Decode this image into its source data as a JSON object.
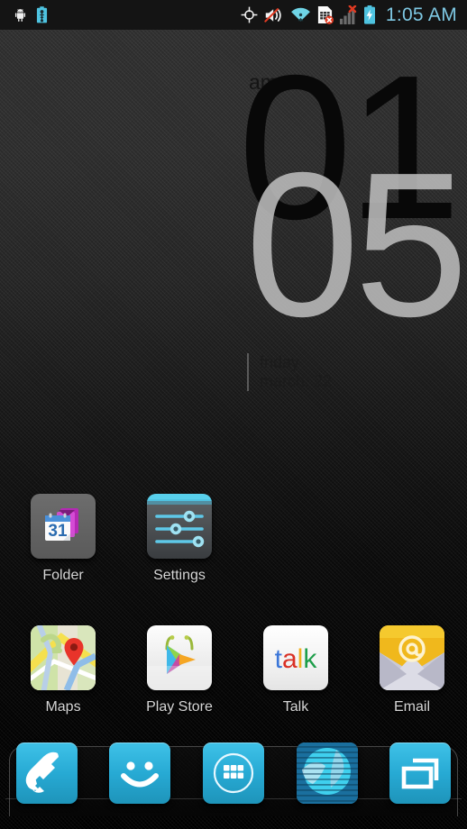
{
  "status_bar": {
    "notification_icons": [
      {
        "name": "android-robot-icon",
        "label": "Android system"
      },
      {
        "name": "battery-charging-notification-icon",
        "label": "Charging"
      }
    ],
    "system_icons": [
      {
        "name": "gps-location-icon",
        "label": "GPS"
      },
      {
        "name": "volume-muted-icon",
        "label": "Silent mode"
      },
      {
        "name": "wifi-icon",
        "label": "Wi-Fi connected"
      },
      {
        "name": "sim-card-error-icon",
        "label": "No SIM card"
      },
      {
        "name": "signal-no-service-icon",
        "label": "No signal"
      },
      {
        "name": "battery-charging-icon",
        "label": "Battery charging"
      }
    ],
    "time": "1:05 AM",
    "time_color": "#7ec8e3",
    "background_color": "#141414"
  },
  "clock_widget": {
    "meridiem": "am",
    "hour": "01",
    "minute": "05",
    "weekday": "friday",
    "date": "march. 22",
    "hour_color": "#080808",
    "minute_color": "#bcbcbc"
  },
  "home_grid": {
    "rows": [
      [
        {
          "name": "folder",
          "label": "Folder",
          "icon": "folder-calendar-icon",
          "visible": true
        },
        {
          "name": "settings",
          "label": "Settings",
          "icon": "settings-sliders-icon",
          "visible": true
        },
        {
          "name": "empty-1",
          "label": "",
          "icon": "",
          "visible": false
        },
        {
          "name": "empty-2",
          "label": "",
          "icon": "",
          "visible": false
        }
      ],
      [
        {
          "name": "maps",
          "label": "Maps",
          "icon": "maps-pin-icon",
          "visible": true
        },
        {
          "name": "play-store",
          "label": "Play Store",
          "icon": "play-store-bag-icon",
          "visible": true
        },
        {
          "name": "talk",
          "label": "Talk",
          "icon": "google-talk-icon",
          "visible": true
        },
        {
          "name": "email",
          "label": "Email",
          "icon": "email-envelope-icon",
          "visible": true
        }
      ]
    ],
    "label_color": "#d6d6d6"
  },
  "dock": {
    "items": [
      {
        "name": "phone",
        "icon": "phone-handset-icon",
        "label": "Phone"
      },
      {
        "name": "messaging",
        "icon": "messaging-smiley-icon",
        "label": "Messaging"
      },
      {
        "name": "app-drawer",
        "icon": "app-drawer-grid-icon",
        "label": "Apps"
      },
      {
        "name": "browser",
        "icon": "browser-globe-icon",
        "label": "Browser"
      },
      {
        "name": "recent-apps",
        "icon": "recent-apps-windows-icon",
        "label": "Recents"
      }
    ],
    "accent_color": "#27aad4"
  },
  "wallpaper": {
    "style": "carbon-fiber-gradient",
    "top_color": "#313131",
    "bottom_color": "#000000"
  }
}
